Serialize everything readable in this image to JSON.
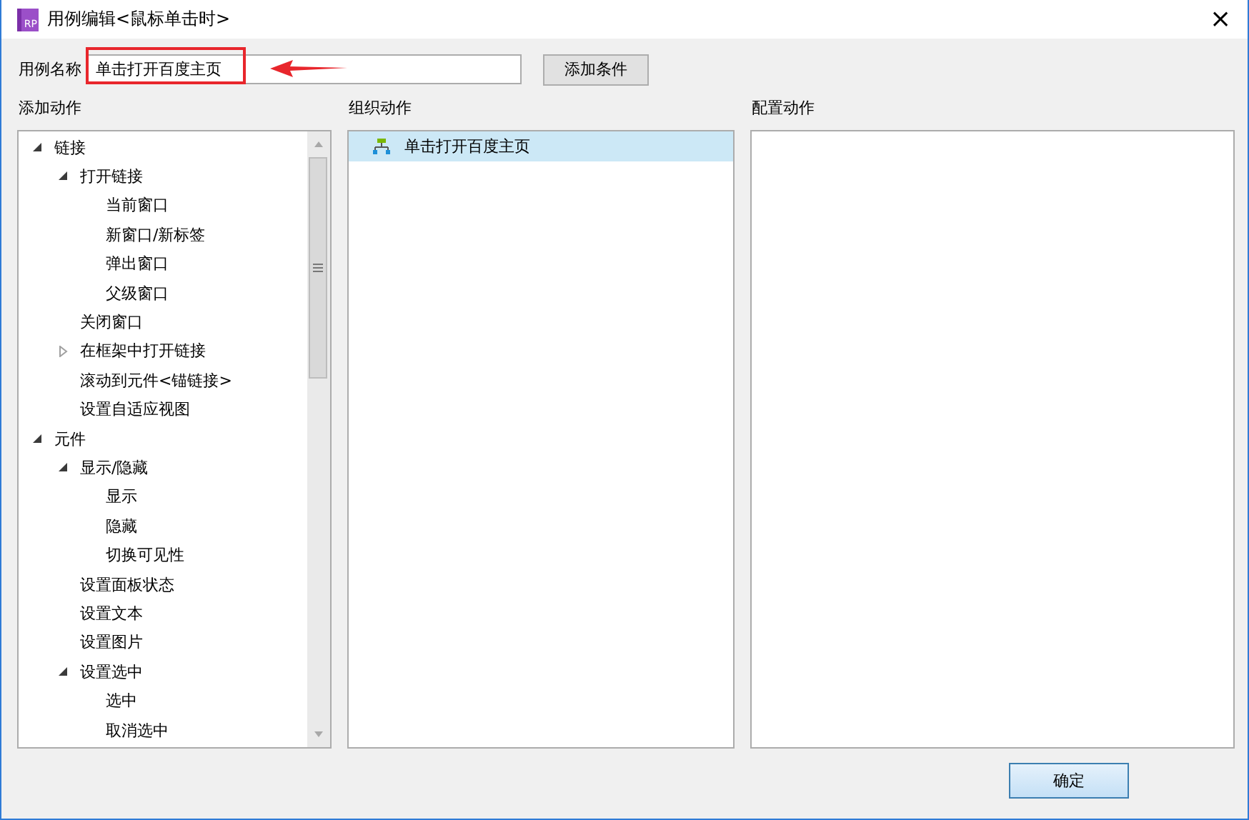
{
  "window": {
    "icon_text": "RP",
    "title": "用例编辑<鼠标单击时>",
    "close": "×"
  },
  "case_name": {
    "label": "用例名称",
    "value": "单击打开百度主页"
  },
  "add_condition": "添加条件",
  "add_actions": {
    "heading": "添加动作",
    "tree": [
      {
        "label": "链接",
        "expanded": true,
        "children": [
          {
            "label": "打开链接",
            "expanded": true,
            "children": [
              {
                "label": "当前窗口"
              },
              {
                "label": "新窗口/新标签"
              },
              {
                "label": "弹出窗口"
              },
              {
                "label": "父级窗口"
              }
            ]
          },
          {
            "label": "关闭窗口"
          },
          {
            "label": "在框架中打开链接",
            "expanded": false
          },
          {
            "label": "滚动到元件<锚链接>"
          },
          {
            "label": "设置自适应视图"
          }
        ]
      },
      {
        "label": "元件",
        "expanded": true,
        "children": [
          {
            "label": "显示/隐藏",
            "expanded": true,
            "children": [
              {
                "label": "显示"
              },
              {
                "label": "隐藏"
              },
              {
                "label": "切换可见性"
              }
            ]
          },
          {
            "label": "设置面板状态"
          },
          {
            "label": "设置文本"
          },
          {
            "label": "设置图片"
          },
          {
            "label": "设置选中",
            "expanded": true,
            "children": [
              {
                "label": "选中"
              },
              {
                "label": "取消选中"
              }
            ]
          }
        ]
      }
    ]
  },
  "organize_actions": {
    "heading": "组织动作",
    "items": [
      {
        "label": "单击打开百度主页",
        "selected": true
      }
    ]
  },
  "configure_actions": {
    "heading": "配置动作"
  },
  "buttons": [
    "确定"
  ]
}
